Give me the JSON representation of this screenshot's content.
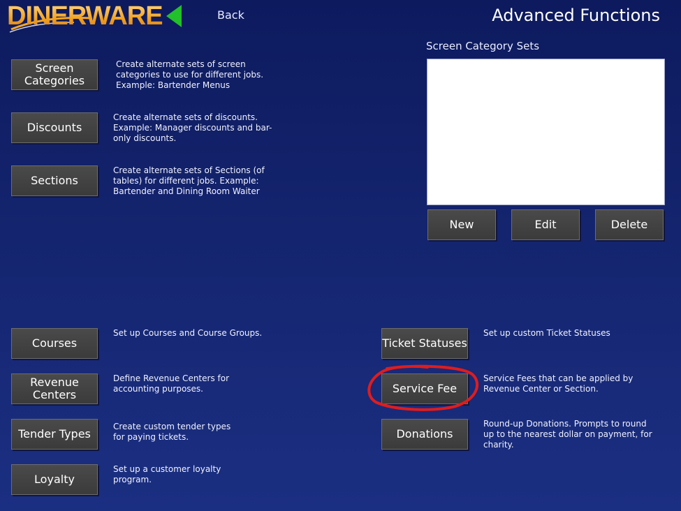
{
  "header": {
    "logo_text": "DINERWARE",
    "back_label": "Back",
    "title": "Advanced Functions"
  },
  "left_top": {
    "screen_categories": {
      "label": "Screen Categories",
      "desc": [
        "Create alternate sets of screen",
        "categories to use for different jobs.",
        "Example: Bartender Menus"
      ]
    },
    "discounts": {
      "label": "Discounts",
      "desc": [
        "Create alternate sets of discounts.",
        "Example: Manager discounts and bar-",
        "only discounts."
      ]
    },
    "sections": {
      "label": "Sections",
      "desc": [
        "Create alternate sets of Sections (of",
        "tables) for different jobs. Example:",
        "Bartender and Dining Room Waiter"
      ]
    }
  },
  "category_sets": {
    "label": "Screen Category Sets",
    "items": [],
    "new_label": "New",
    "edit_label": "Edit",
    "delete_label": "Delete"
  },
  "left_bottom": {
    "courses": {
      "label": "Courses",
      "desc": [
        "Set up Courses and Course Groups."
      ]
    },
    "revenue_centers": {
      "label": "Revenue Centers",
      "desc": [
        "Define Revenue Centers for",
        "accounting purposes."
      ]
    },
    "tender_types": {
      "label": "Tender Types",
      "desc": [
        "Create custom tender types",
        "for paying tickets."
      ]
    },
    "loyalty": {
      "label": "Loyalty",
      "desc": [
        "Set up a customer loyalty",
        "program."
      ]
    }
  },
  "right_bottom": {
    "ticket_statuses": {
      "label": "Ticket Statuses",
      "desc": [
        "Set up custom Ticket Statuses"
      ]
    },
    "service_fee": {
      "label": "Service Fee",
      "desc": [
        "Service Fees that can be applied by",
        "Revenue Center or Section."
      ]
    },
    "donations": {
      "label": "Donations",
      "desc": [
        "Round-up Donations. Prompts to round",
        "up to the nearest dollar on payment, for",
        "charity."
      ]
    }
  },
  "colors": {
    "background": "#14246e",
    "button": "#424242",
    "back_arrow": "#22c02a",
    "highlight_circle": "#e01c1c",
    "logo": "#f5a623"
  }
}
